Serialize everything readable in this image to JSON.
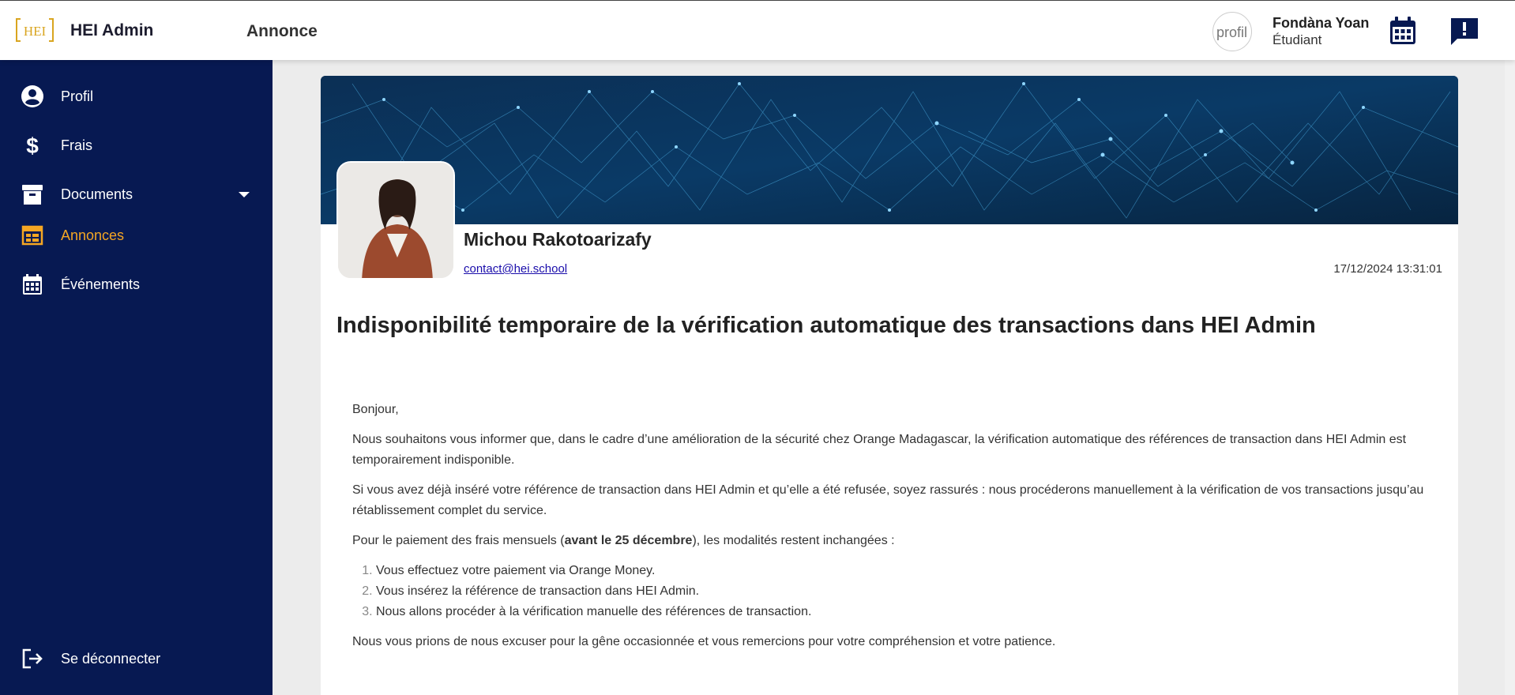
{
  "app": {
    "brand": "HEI Admin",
    "logo_text": "HEI",
    "page_title": "Annonce"
  },
  "user": {
    "avatar_alt": "profil",
    "name": "Fondàna Yoan",
    "role": "Étudiant"
  },
  "icons": {
    "calendar": "calendar-icon",
    "feedback": "feedback-icon"
  },
  "colors": {
    "sidebar": "#071952",
    "accent": "#f5a623"
  },
  "sidebar": {
    "items": [
      {
        "label": "Profil",
        "icon": "account-circle-icon"
      },
      {
        "label": "Frais",
        "icon": "dollar-icon"
      },
      {
        "label": "Documents",
        "icon": "archive-icon"
      },
      {
        "label": "Annonces",
        "icon": "announcement-icon",
        "active": true
      },
      {
        "label": "Événements",
        "icon": "calendar-icon"
      }
    ],
    "logout": "Se déconnecter"
  },
  "post": {
    "author_name": "Michou Rakotoarizafy",
    "author_email": "contact@hei.school",
    "date": "17/12/2024 13:31:01",
    "title": "Indisponibilité temporaire de la vérification automatique des transactions dans HEI Admin",
    "greeting": "Bonjour,",
    "p1": "Nous souhaitons vous informer que, dans le cadre d’une amélioration de la sécurité chez Orange Madagascar, la vérification automatique des références de transaction dans HEI Admin est temporairement indisponible.",
    "p2": "Si vous avez déjà inséré votre référence de transaction dans HEI Admin et qu’elle a été refusée, soyez rassurés : nous procéderons manuellement à la vérification de vos transactions jusqu’au rétablissement complet du service.",
    "p3_before": "Pour le paiement des frais mensuels (",
    "p3_bold": "avant le 25 décembre",
    "p3_after": "), les modalités restent inchangées :",
    "steps": [
      "Vous effectuez votre paiement via Orange Money.",
      "Vous insérez la référence de transaction dans HEI Admin.",
      "Nous allons procéder à la vérification manuelle des références de transaction."
    ],
    "closing": "Nous vous prions de nous excuser pour la gêne occasionnée et vous remercions pour votre compréhension et votre patience."
  }
}
